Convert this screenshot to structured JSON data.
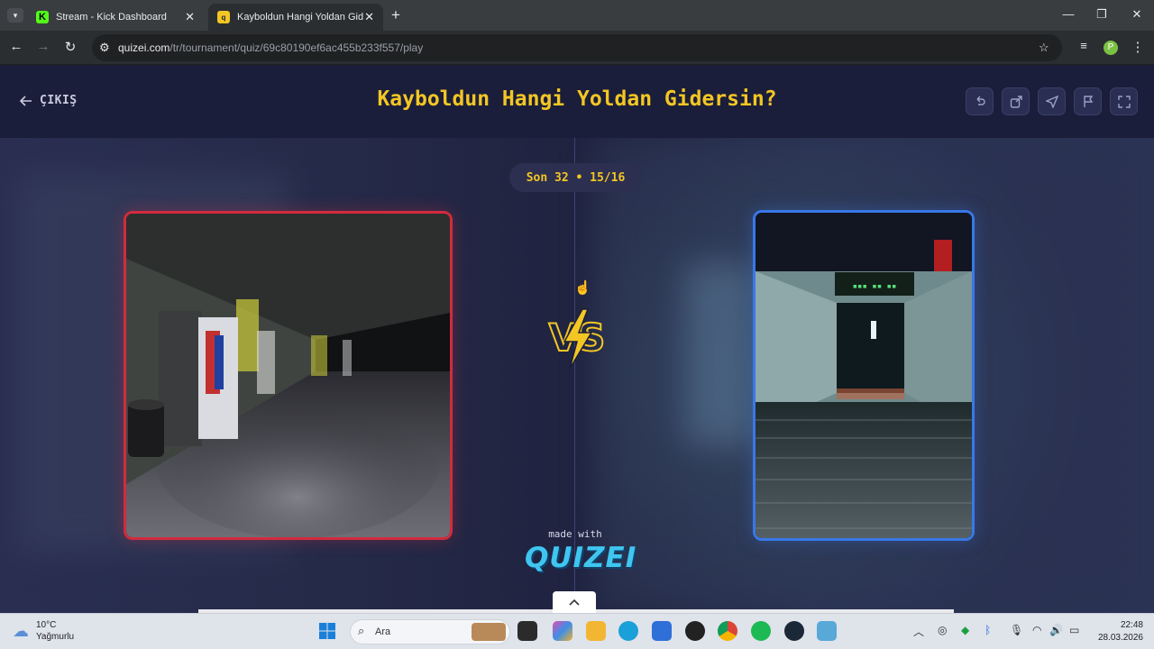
{
  "browser": {
    "tabs": [
      {
        "title": "Stream - Kick Dashboard",
        "active": false
      },
      {
        "title": "Kayboldun Hangi Yoldan Gidersi",
        "active": true
      }
    ],
    "url_host": "quizei.com",
    "url_path": "/tr/tournament/quiz/69c80190ef6ac455b233f557/play",
    "profile_initial": "P"
  },
  "header": {
    "exit_label": "ÇIKIŞ",
    "title": "Kayboldun Hangi Yoldan Gidersin?"
  },
  "round": {
    "label": "Son 32 • 15/16"
  },
  "vs_label": "VS",
  "footer": {
    "made_with": "made with",
    "logo": "QUIZEI"
  },
  "taskbar": {
    "weather_temp": "10°C",
    "weather_desc": "Yağmurlu",
    "search_placeholder": "Ara",
    "time": "22:48",
    "date": "28.03.2026"
  },
  "colors": {
    "accent": "#f3c624",
    "left_border": "#d22b3e",
    "right_border": "#3878e8",
    "logo": "#3ec6f0"
  }
}
